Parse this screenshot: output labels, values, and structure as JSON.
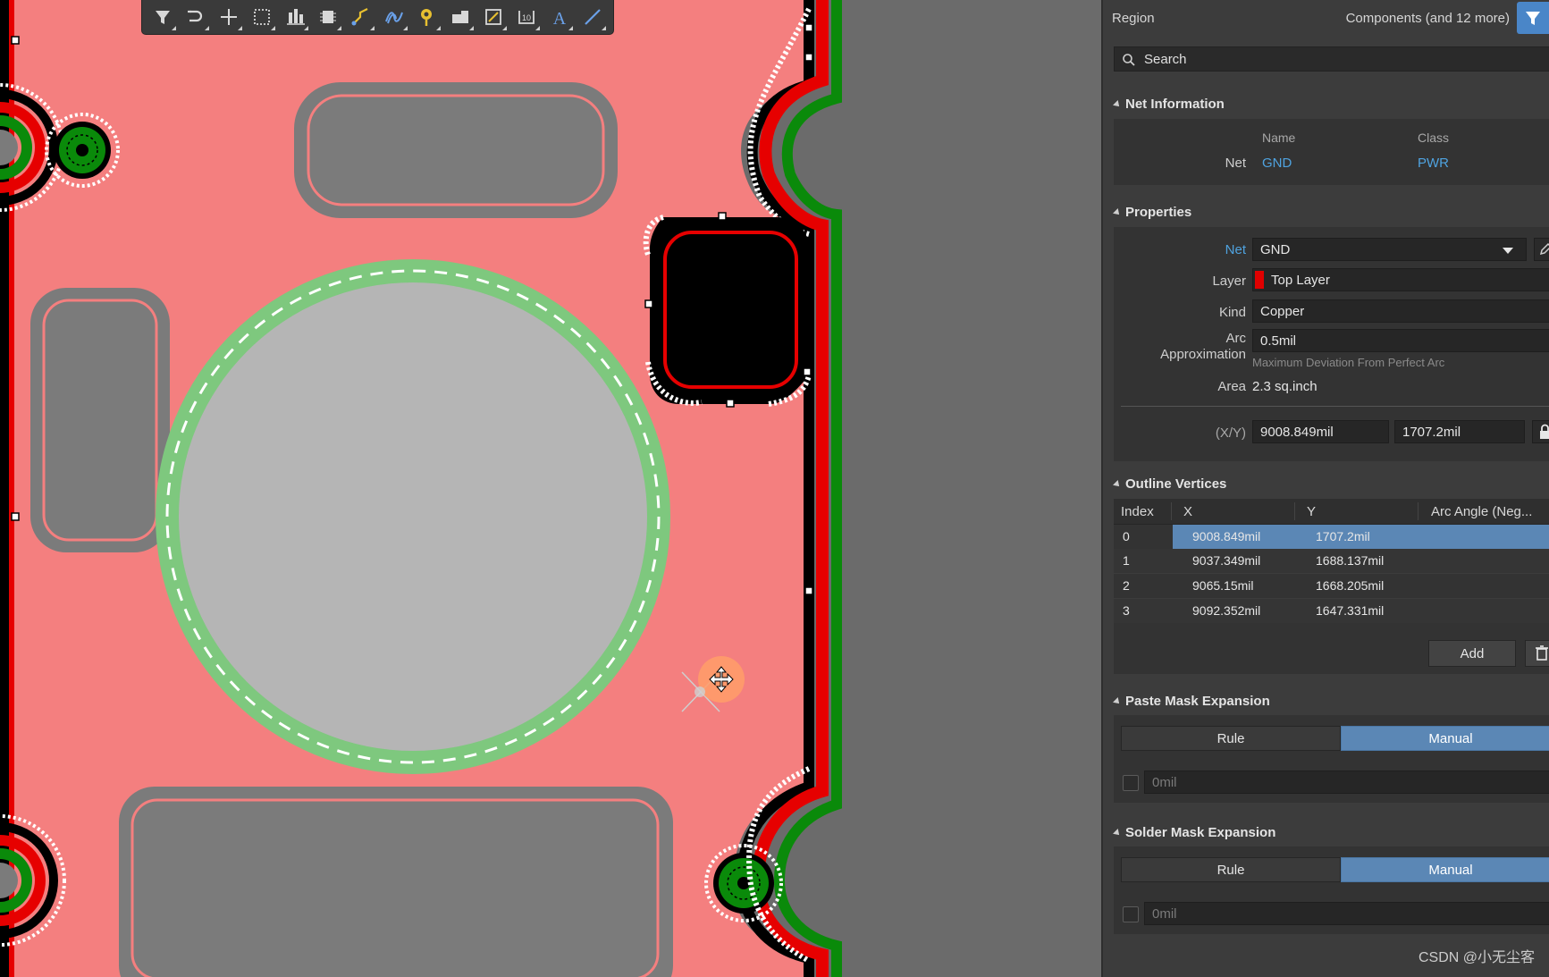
{
  "toolbar": {
    "tools": [
      {
        "icon": "filter-icon",
        "color": "#d8d8d8"
      },
      {
        "icon": "route-icon",
        "color": "#d8d8d8"
      },
      {
        "icon": "crosshair-add-icon",
        "color": "#d8d8d8"
      },
      {
        "icon": "select-rect-icon",
        "color": "#d8d8d8"
      },
      {
        "icon": "align-icon",
        "color": "#d8d8d8"
      },
      {
        "icon": "component-icon",
        "color": "#d8d8d8"
      },
      {
        "icon": "interactive-route-icon",
        "color": "#e8c030"
      },
      {
        "icon": "diff-pair-icon",
        "color": "#6aa0e8"
      },
      {
        "icon": "via-icon",
        "color": "#e8c030"
      },
      {
        "icon": "polygon-pour-icon",
        "color": "#d8d8d8"
      },
      {
        "icon": "fill-icon",
        "color": "#d8d8d8"
      },
      {
        "icon": "place-string-icon",
        "color": "#d8d8d8"
      },
      {
        "icon": "text-icon",
        "color": "#6aa0e8"
      },
      {
        "icon": "line-icon",
        "color": "#6aa0e8"
      }
    ]
  },
  "board": {
    "colors": {
      "copper_region": "#f47f7f",
      "cutout": "#7b7b7b",
      "large_cutout": "#b5b5b5",
      "ring": "#7ec87e",
      "edge_red": "#e60000",
      "edge_green": "#0a8a0a",
      "edge_black": "#000000",
      "selected_pad": "#000000",
      "cursor": "#ff9e68"
    }
  },
  "panel": {
    "header": {
      "left": "Region",
      "right": "Components (and 12 more)"
    },
    "search": {
      "placeholder": "Search"
    },
    "net_info": {
      "title": "Net Information",
      "col_name": "Name",
      "col_class": "Class",
      "row_label": "Net",
      "name": "GND",
      "class": "PWR"
    },
    "properties": {
      "title": "Properties",
      "net_label": "Net",
      "net_value": "GND",
      "layer_label": "Layer",
      "layer_value": "Top Layer",
      "layer_color": "#e00000",
      "kind_label": "Kind",
      "kind_value": "Copper",
      "arc_label_1": "Arc",
      "arc_label_2": "Approximation",
      "arc_value": "0.5mil",
      "arc_hint": "Maximum Deviation From Perfect Arc",
      "area_label": "Area",
      "area_value": "2.3 sq.inch",
      "xy_label": "(X/Y)",
      "x_value": "9008.849mil",
      "y_value": "1707.2mil"
    },
    "vertices": {
      "title": "Outline Vertices",
      "headers": [
        "Index",
        "X",
        "Y",
        "Arc Angle (Neg..."
      ],
      "rows": [
        {
          "index": "0",
          "x": "9008.849mil",
          "y": "1707.2mil"
        },
        {
          "index": "1",
          "x": "9037.349mil",
          "y": "1688.137mil"
        },
        {
          "index": "2",
          "x": "9065.15mil",
          "y": "1668.205mil"
        },
        {
          "index": "3",
          "x": "9092.352mil",
          "y": "1647.331mil"
        }
      ],
      "add_label": "Add"
    },
    "paste_mask": {
      "title": "Paste Mask Expansion",
      "rule": "Rule",
      "manual": "Manual",
      "value": "0mil"
    },
    "solder_mask": {
      "title": "Solder Mask Expansion",
      "rule": "Rule",
      "manual": "Manual",
      "value": "0mil"
    }
  },
  "watermark": "CSDN @小无尘客"
}
